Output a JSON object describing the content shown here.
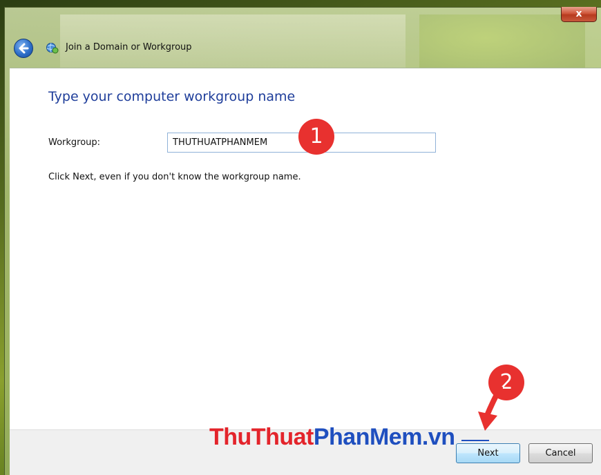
{
  "window": {
    "title": "Join a Domain or Workgroup",
    "close_label": "x",
    "icons": {
      "back": "back-arrow-icon",
      "network": "network-globe-icon"
    }
  },
  "page": {
    "heading": "Type your computer workgroup name",
    "workgroup_label": "Workgroup:",
    "workgroup_value": "THUTHUATPHANMEM",
    "hint": "Click Next, even if you don't know the workgroup name."
  },
  "buttons": {
    "next": "Next",
    "cancel": "Cancel"
  },
  "annotations": {
    "step1": "1",
    "step2": "2",
    "accent_color": "#e8312f"
  },
  "watermark": {
    "part1": "ThuThuat",
    "part2": "PhanMem.vn"
  }
}
